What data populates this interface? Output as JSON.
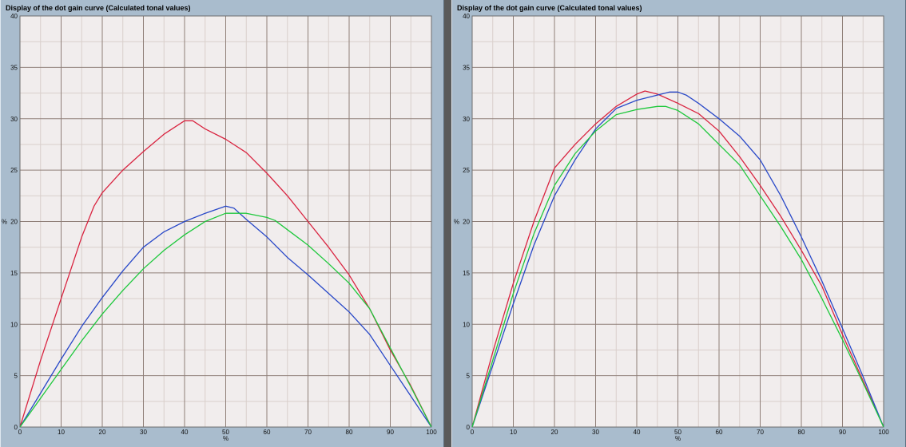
{
  "panels": [
    {
      "title": "Display of the dot gain curve (Calculated tonal values)"
    },
    {
      "title": "Display of the dot gain curve (Calculated tonal values)"
    }
  ],
  "colors": {
    "plot_bg": "#f1eded",
    "grid_major": "#8f7f78",
    "grid_minor": "#d9cfcb",
    "red": "#d92440",
    "blue": "#2848c8",
    "green": "#1ec83c"
  },
  "chart_data": [
    {
      "type": "line",
      "title": "Display of the dot gain curve (Calculated tonal values)",
      "xlabel": "%",
      "ylabel": "%",
      "xlim": [
        0,
        100
      ],
      "ylim": [
        0,
        40
      ],
      "x_ticks": [
        0,
        10,
        20,
        30,
        40,
        50,
        60,
        70,
        80,
        90,
        100
      ],
      "y_ticks": [
        0,
        5,
        10,
        15,
        20,
        25,
        30,
        35,
        40
      ],
      "grid": true,
      "series": [
        {
          "color": "#d92440",
          "points": [
            [
              0,
              0
            ],
            [
              5,
              6.5
            ],
            [
              10,
              12.5
            ],
            [
              15,
              18.5
            ],
            [
              18,
              21.5
            ],
            [
              20,
              22.8
            ],
            [
              25,
              25
            ],
            [
              30,
              26.8
            ],
            [
              35,
              28.5
            ],
            [
              40,
              29.8
            ],
            [
              42,
              29.8
            ],
            [
              45,
              29
            ],
            [
              50,
              28
            ],
            [
              55,
              26.7
            ],
            [
              60,
              24.7
            ],
            [
              65,
              22.5
            ],
            [
              70,
              20
            ],
            [
              75,
              17.5
            ],
            [
              80,
              14.8
            ],
            [
              85,
              11.5
            ],
            [
              90,
              7.5
            ],
            [
              95,
              4
            ],
            [
              100,
              0
            ]
          ]
        },
        {
          "color": "#2848c8",
          "points": [
            [
              0,
              0
            ],
            [
              5,
              3.3
            ],
            [
              10,
              6.6
            ],
            [
              15,
              9.8
            ],
            [
              20,
              12.6
            ],
            [
              25,
              15.2
            ],
            [
              30,
              17.5
            ],
            [
              35,
              19
            ],
            [
              40,
              20
            ],
            [
              45,
              20.8
            ],
            [
              50,
              21.5
            ],
            [
              52,
              21.3
            ],
            [
              55,
              20.2
            ],
            [
              60,
              18.5
            ],
            [
              65,
              16.5
            ],
            [
              70,
              14.8
            ],
            [
              75,
              13
            ],
            [
              80,
              11.2
            ],
            [
              85,
              9
            ],
            [
              90,
              6
            ],
            [
              95,
              3
            ],
            [
              100,
              0
            ]
          ]
        },
        {
          "color": "#1ec83c",
          "points": [
            [
              0,
              0
            ],
            [
              5,
              2.8
            ],
            [
              10,
              5.6
            ],
            [
              15,
              8.4
            ],
            [
              20,
              11
            ],
            [
              25,
              13.3
            ],
            [
              30,
              15.4
            ],
            [
              35,
              17.2
            ],
            [
              40,
              18.7
            ],
            [
              45,
              20
            ],
            [
              50,
              20.8
            ],
            [
              55,
              20.8
            ],
            [
              60,
              20.4
            ],
            [
              62,
              20.1
            ],
            [
              65,
              19.2
            ],
            [
              70,
              17.7
            ],
            [
              75,
              15.9
            ],
            [
              80,
              14
            ],
            [
              85,
              11.5
            ],
            [
              90,
              7.7
            ],
            [
              95,
              3.9
            ],
            [
              100,
              0
            ]
          ]
        }
      ]
    },
    {
      "type": "line",
      "title": "Display of the dot gain curve (Calculated tonal values)",
      "xlabel": "%",
      "ylabel": "%",
      "xlim": [
        0,
        100
      ],
      "ylim": [
        0,
        40
      ],
      "x_ticks": [
        0,
        10,
        20,
        30,
        40,
        50,
        60,
        70,
        80,
        90,
        100
      ],
      "y_ticks": [
        0,
        5,
        10,
        15,
        20,
        25,
        30,
        35,
        40
      ],
      "grid": true,
      "series": [
        {
          "color": "#d92440",
          "points": [
            [
              0,
              0
            ],
            [
              5,
              7.3
            ],
            [
              10,
              14
            ],
            [
              15,
              20
            ],
            [
              20,
              25.2
            ],
            [
              25,
              27.5
            ],
            [
              30,
              29.5
            ],
            [
              35,
              31.2
            ],
            [
              40,
              32.4
            ],
            [
              42,
              32.7
            ],
            [
              45,
              32.4
            ],
            [
              50,
              31.5
            ],
            [
              55,
              30.5
            ],
            [
              60,
              28.8
            ],
            [
              65,
              26.3
            ],
            [
              70,
              23.5
            ],
            [
              75,
              20.5
            ],
            [
              80,
              17.2
            ],
            [
              85,
              13.7
            ],
            [
              90,
              9
            ],
            [
              95,
              4.5
            ],
            [
              100,
              0
            ]
          ]
        },
        {
          "color": "#2848c8",
          "points": [
            [
              0,
              0
            ],
            [
              5,
              6
            ],
            [
              10,
              12
            ],
            [
              15,
              17.7
            ],
            [
              20,
              22.5
            ],
            [
              25,
              26
            ],
            [
              30,
              29
            ],
            [
              35,
              31
            ],
            [
              40,
              31.8
            ],
            [
              45,
              32.3
            ],
            [
              48,
              32.6
            ],
            [
              50,
              32.6
            ],
            [
              52,
              32.3
            ],
            [
              55,
              31.5
            ],
            [
              60,
              30
            ],
            [
              65,
              28.3
            ],
            [
              70,
              26
            ],
            [
              75,
              22.5
            ],
            [
              80,
              18.5
            ],
            [
              85,
              14.2
            ],
            [
              90,
              9.6
            ],
            [
              95,
              4.9
            ],
            [
              100,
              0
            ]
          ]
        },
        {
          "color": "#1ec83c",
          "points": [
            [
              0,
              0
            ],
            [
              5,
              6.5
            ],
            [
              10,
              13
            ],
            [
              15,
              18.8
            ],
            [
              20,
              23.5
            ],
            [
              25,
              26.6
            ],
            [
              30,
              28.8
            ],
            [
              35,
              30.4
            ],
            [
              40,
              30.9
            ],
            [
              45,
              31.2
            ],
            [
              47,
              31.2
            ],
            [
              50,
              30.8
            ],
            [
              55,
              29.5
            ],
            [
              60,
              27.5
            ],
            [
              65,
              25.5
            ],
            [
              70,
              22.5
            ],
            [
              75,
              19.5
            ],
            [
              80,
              16.3
            ],
            [
              85,
              12.5
            ],
            [
              90,
              8.5
            ],
            [
              95,
              4.3
            ],
            [
              100,
              0
            ]
          ]
        }
      ]
    }
  ]
}
